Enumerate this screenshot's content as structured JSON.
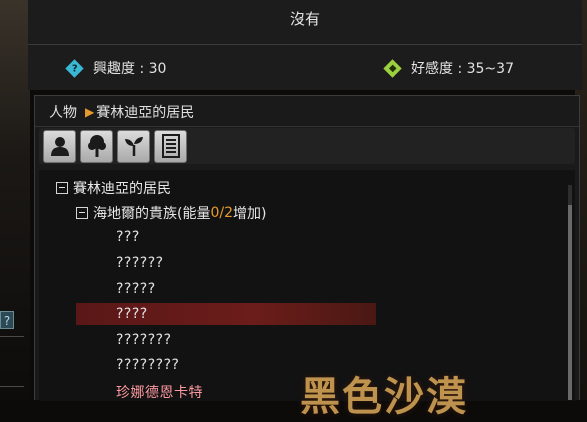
{
  "top": {
    "title": "沒有",
    "interest_label": "興趣度 : 30",
    "favor_label": "好感度 : 35~37"
  },
  "breadcrumb": {
    "root": "人物",
    "current": "賽林迪亞的居民"
  },
  "toolbar": {
    "buttons": [
      "person-icon",
      "tree-icon",
      "sprout-icon",
      "book-icon"
    ]
  },
  "tree": {
    "group": "賽林迪亞的居民",
    "subgroup_prefix": "海地爾的貴族(能量 ",
    "subgroup_energy": "0/2",
    "subgroup_suffix": " 增加)",
    "items": [
      "???",
      "??????",
      "?????",
      "????",
      "???????",
      "????????",
      "珍娜德恩卡特"
    ]
  },
  "watermark": "黑色沙漠",
  "colors": {
    "accent_orange": "#e89a2c",
    "interest_icon": "#3ab7d3",
    "favor_icon": "#9bd13f",
    "selected_text": "#ff9aa0"
  }
}
